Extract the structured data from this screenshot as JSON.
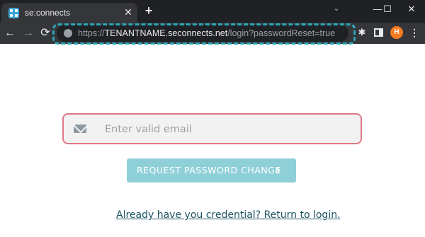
{
  "browser": {
    "tab_title": "se:connects",
    "tab_close": "✕",
    "new_tab": "+",
    "tab_search": "⌄",
    "window_controls": {
      "minimize": "—",
      "maximize": "☐",
      "close": "✕"
    },
    "nav": {
      "back": "←",
      "forward": "→",
      "reload": "⟳"
    },
    "url": {
      "scheme": "https://",
      "host": "TENANTNAME.seconnects.net",
      "path": "/login?passwordReset=true"
    },
    "extensions_icon": "✱",
    "profile_initial": "H",
    "menu": "⋮",
    "colors": {
      "highlight": "#2aa6b8",
      "profile": "#f47b20"
    }
  },
  "form": {
    "email": {
      "value": "",
      "placeholder": "Enter valid email",
      "icon": "envelope-icon"
    },
    "submit_label": "REQUEST PASSWORD CHANGE",
    "submit_icon": "›",
    "return_link": "Already have you credential? Return to login.",
    "colors": {
      "input_border": "#e0778a",
      "button": "#8fd0d8",
      "link": "#1c5261"
    }
  }
}
